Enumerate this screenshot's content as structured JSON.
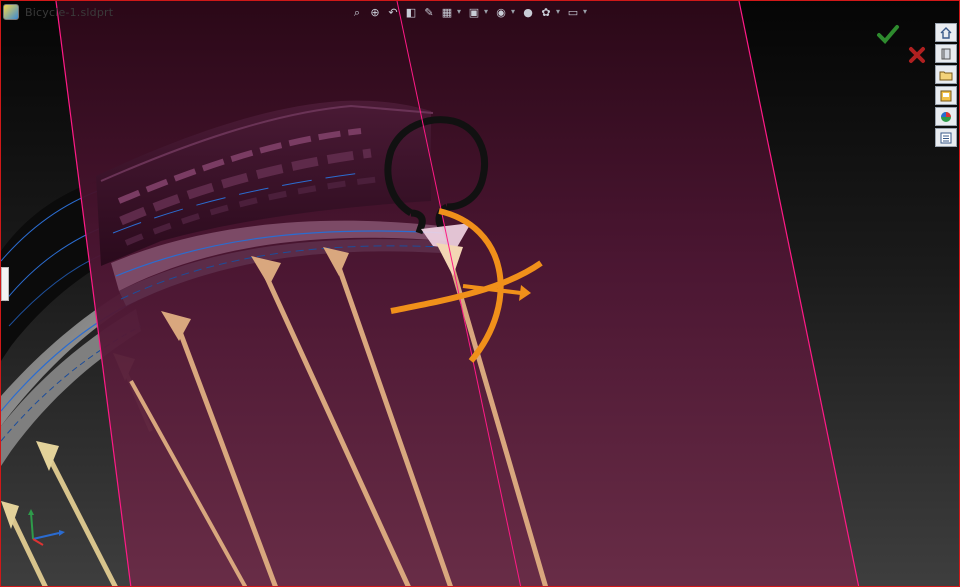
{
  "document": {
    "title": "Bicycle-1.sldprt"
  },
  "heads_up_toolbar": {
    "buttons": [
      {
        "icon": "zoom-to-fit-icon",
        "glyph": "⌕"
      },
      {
        "icon": "zoom-to-area-icon",
        "glyph": "⊕"
      },
      {
        "icon": "previous-view-icon",
        "glyph": "↶"
      },
      {
        "icon": "section-view-icon",
        "glyph": "◧"
      },
      {
        "icon": "dynamic-annotation-icon",
        "glyph": "✎"
      },
      {
        "icon": "view-orientation-icon",
        "glyph": "▦",
        "dropdown": true
      },
      {
        "icon": "display-style-icon",
        "glyph": "▣",
        "dropdown": true
      },
      {
        "icon": "hide-show-items-icon",
        "glyph": "◉",
        "dropdown": true
      },
      {
        "icon": "edit-appearance-icon",
        "glyph": "●"
      },
      {
        "icon": "apply-scene-icon",
        "glyph": "✿",
        "dropdown": true
      },
      {
        "icon": "view-settings-icon",
        "glyph": "▭",
        "dropdown": true
      }
    ]
  },
  "confirmation_corner": {
    "ok_icon": "checkmark-icon",
    "cancel_icon": "x-cancel-icon",
    "ok_color": "#2e8b2e",
    "cancel_color": "#b02020"
  },
  "task_pane": {
    "tabs": [
      {
        "icon": "home-icon"
      },
      {
        "icon": "design-library-icon"
      },
      {
        "icon": "file-explorer-icon"
      },
      {
        "icon": "view-palette-icon"
      },
      {
        "icon": "appearances-scenes-icon"
      },
      {
        "icon": "custom-properties-icon"
      }
    ]
  },
  "colors": {
    "plane_fill": "#5a1638",
    "plane_edge": "#ff1a86",
    "tire": "#2b0b20",
    "spoke": "#d9a77e",
    "rim": "#9a9a9a",
    "move_handle": "#f0901a",
    "frame_border": "#d01818"
  }
}
